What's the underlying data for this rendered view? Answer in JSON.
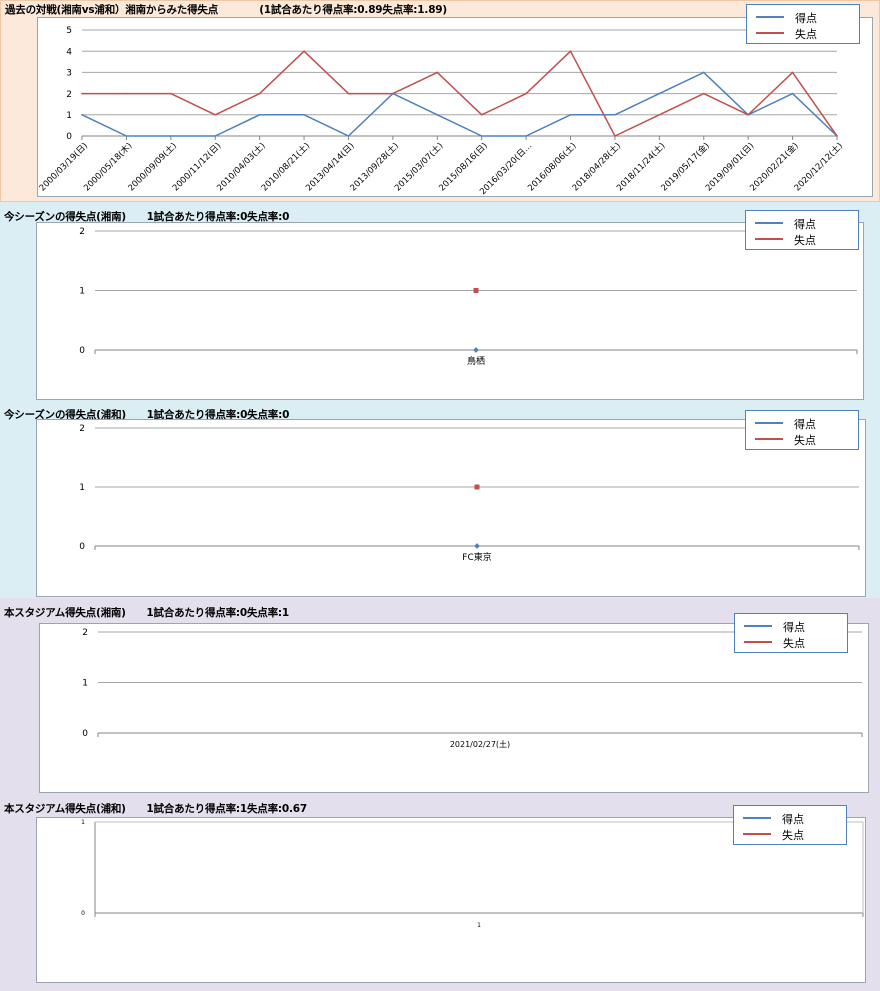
{
  "colors": {
    "score": "#4f81bd",
    "concede": "#c0504d",
    "grid": "#a6a6a6",
    "sec1_bg": "#fde9d9",
    "sec2_bg": "#daeef3",
    "sec4_bg": "#e4dfec"
  },
  "legend": {
    "score": "得点",
    "concede": "失点"
  },
  "sections": [
    {
      "title": "過去の対戦(湘南vs浦和）湘南からみた得失点　　　　(1試合あたり得点率:0.89失点率:1.89)",
      "chart_data": {
        "type": "line",
        "categories": [
          "2000/03/19(日)",
          "2000/05/18(木)",
          "2000/09/09(土)",
          "2000/11/12(日)",
          "2010/04/03(土)",
          "2010/08/21(土)",
          "2013/04/14(日)",
          "2013/09/28(土)",
          "2015/03/07(土)",
          "2015/08/16(日)",
          "2016/03/20(日…",
          "2016/08/06(土)",
          "2018/04/28(土)",
          "2018/11/24(土)",
          "2019/05/17(金)",
          "2019/09/01(日)",
          "2020/02/21(金)",
          "2020/12/12(土)"
        ],
        "series": [
          {
            "name": "得点",
            "values": [
              1,
              0,
              0,
              0,
              1,
              1,
              0,
              2,
              1,
              0,
              0,
              1,
              1,
              2,
              3,
              1,
              2,
              0
            ]
          },
          {
            "name": "失点",
            "values": [
              2,
              2,
              2,
              1,
              2,
              4,
              2,
              2,
              3,
              1,
              2,
              4,
              0,
              1,
              2,
              1,
              3,
              0
            ]
          }
        ],
        "ylim": [
          0,
          5
        ],
        "yticks": [
          0,
          1,
          2,
          3,
          4,
          5
        ],
        "grid": true,
        "legend_position": "top-right"
      }
    },
    {
      "title": "今シーズンの得失点(湘南)　　1試合あたり得点率:0失点率:0",
      "chart_data": {
        "type": "line",
        "categories": [
          "鳥栖"
        ],
        "series": [
          {
            "name": "得点",
            "values": [
              0
            ]
          },
          {
            "name": "失点",
            "values": [
              1
            ]
          }
        ],
        "ylim": [
          0,
          2
        ],
        "yticks": [
          0,
          1,
          2
        ],
        "grid": true,
        "legend_position": "top-right"
      }
    },
    {
      "title": "今シーズンの得失点(浦和)　　1試合あたり得点率:0失点率:0",
      "chart_data": {
        "type": "line",
        "categories": [
          "FC東京"
        ],
        "series": [
          {
            "name": "得点",
            "values": [
              0
            ]
          },
          {
            "name": "失点",
            "values": [
              1
            ]
          }
        ],
        "ylim": [
          0,
          2
        ],
        "yticks": [
          0,
          1,
          2
        ],
        "grid": true,
        "legend_position": "top-right"
      }
    },
    {
      "title": "本スタジアム得失点(湘南)　　1試合あたり得点率:0失点率:1",
      "chart_data": {
        "type": "line",
        "categories": [
          "2021/02/27(土)"
        ],
        "series": [
          {
            "name": "得点",
            "values": []
          },
          {
            "name": "失点",
            "values": []
          }
        ],
        "ylim": [
          0,
          2
        ],
        "yticks": [
          0,
          1,
          2
        ],
        "grid": true,
        "legend_position": "top-right"
      }
    },
    {
      "title": "本スタジアム得失点(浦和)　　1試合あたり得点率:1失点率:0.67",
      "chart_data": {
        "type": "line",
        "categories": [
          "1"
        ],
        "series": [
          {
            "name": "得点",
            "values": []
          },
          {
            "name": "失点",
            "values": []
          }
        ],
        "ylim": [
          0,
          1
        ],
        "yticks": [
          0,
          1
        ],
        "grid": false,
        "legend_position": "top-right"
      }
    }
  ]
}
